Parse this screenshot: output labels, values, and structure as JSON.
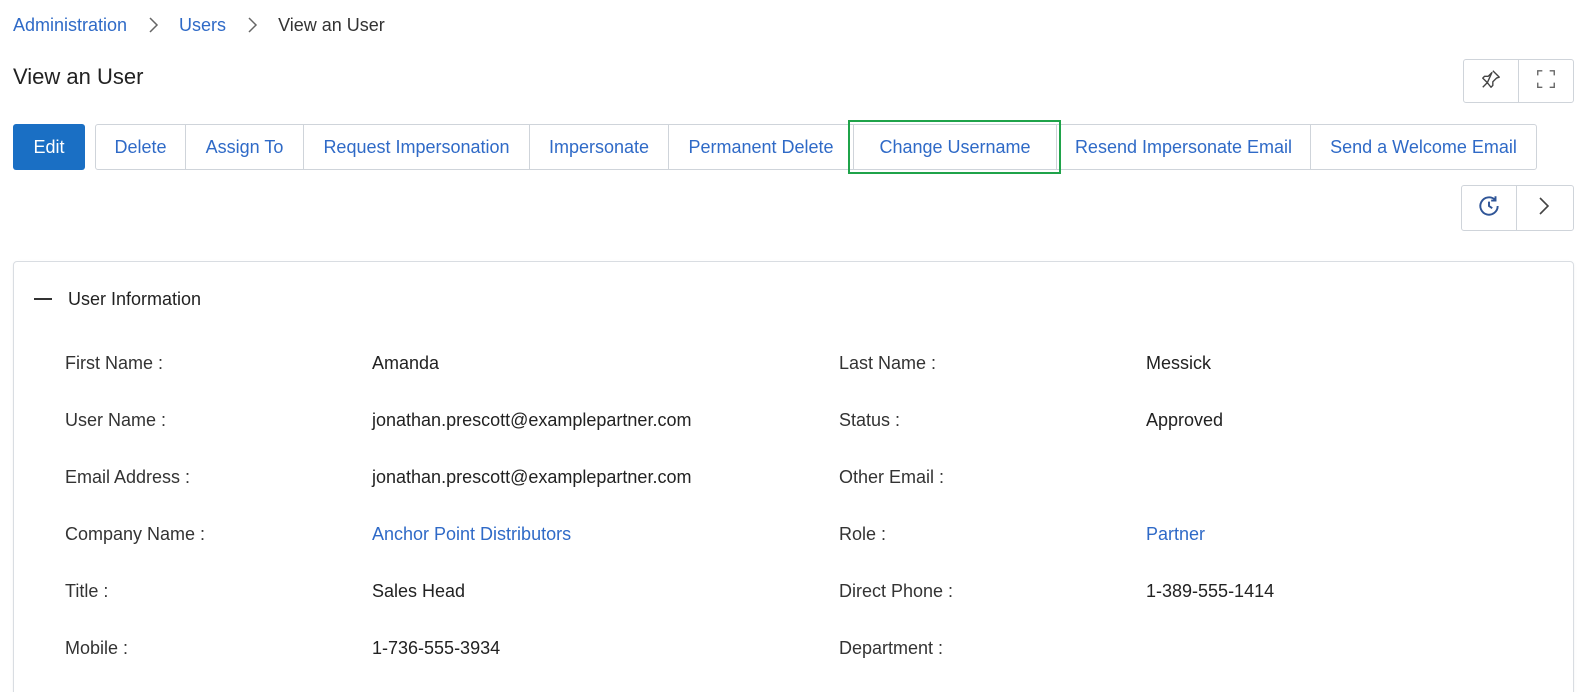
{
  "breadcrumb": {
    "items": [
      "Administration",
      "Users"
    ],
    "current": "View an User"
  },
  "page_title": "View an User",
  "toolbar": {
    "edit": "Edit",
    "buttons": [
      "Delete",
      "Assign To",
      "Request Impersonation",
      "Impersonate",
      "Permanent Delete",
      "Change Username",
      "Resend Impersonate Email",
      "Send a Welcome Email"
    ],
    "highlighted": "Change Username"
  },
  "icons": {
    "pin": "pin-icon",
    "fullscreen": "fullscreen-icon",
    "history": "history-icon",
    "next": "chevron-right-icon"
  },
  "section": {
    "title": "User Information",
    "fields": [
      {
        "label": "First Name :",
        "value": "Amanda"
      },
      {
        "label": "Last Name :",
        "value": "Messick"
      },
      {
        "label": "User Name :",
        "value": "jonathan.prescott@examplepartner.com"
      },
      {
        "label": "Status :",
        "value": "Approved"
      },
      {
        "label": "Email Address :",
        "value": "jonathan.prescott@examplepartner.com"
      },
      {
        "label": "Other Email :",
        "value": ""
      },
      {
        "label": "Company Name :",
        "value": "Anchor Point Distributors"
      },
      {
        "label": "Role :",
        "value": "Partner"
      },
      {
        "label": "Title :",
        "value": "Sales Head"
      },
      {
        "label": "Direct Phone :",
        "value": "1-389-555-1414"
      },
      {
        "label": "Mobile :",
        "value": "1-736-555-3934"
      },
      {
        "label": "Department :",
        "value": ""
      }
    ]
  },
  "colors": {
    "primary": "#1a6fc4",
    "link": "#2f6ac7",
    "highlight": "#1fa34a"
  }
}
